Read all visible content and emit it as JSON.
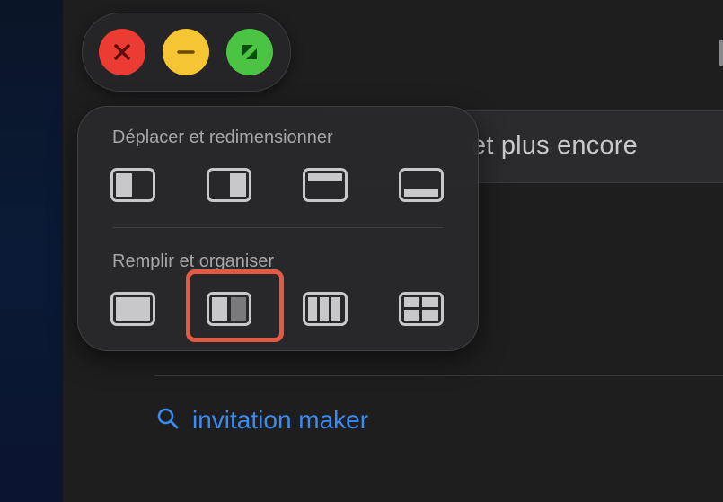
{
  "search": {
    "visible_text": "et plus encore"
  },
  "suggestion": {
    "icon": "search-icon",
    "text": "invitation maker"
  },
  "window_controls": {
    "close_icon": "close-icon",
    "minimize_icon": "minimize-icon",
    "zoom_icon": "fullscreen-icon",
    "colors": {
      "close": "#ec3b33",
      "minimize": "#f6c533",
      "zoom": "#4cc443"
    }
  },
  "popover": {
    "move_resize_title": "Déplacer et redimensionner",
    "fill_arrange_title": "Remplir et organiser",
    "move_resize_options": [
      "left-half",
      "right-half",
      "top-half",
      "bottom-half"
    ],
    "fill_arrange_options": [
      "fill",
      "left-right-split",
      "three-columns",
      "four-quarters"
    ],
    "highlighted_option": "left-right-split",
    "highlight_color": "#e25a43"
  },
  "accent_color": "#3b8bf0"
}
